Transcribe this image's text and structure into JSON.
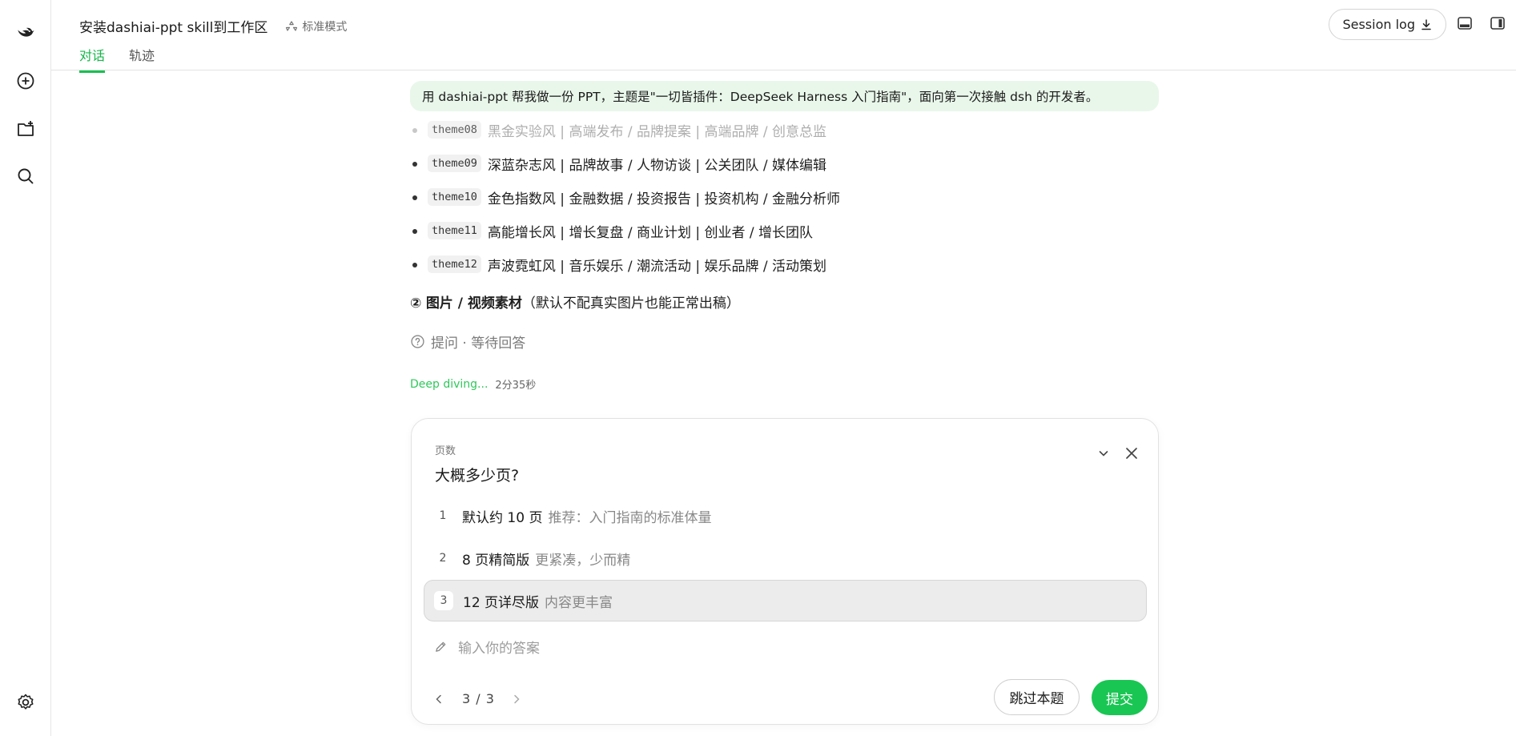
{
  "header": {
    "title": "安装dashiai-ppt skill到工作区",
    "mode_label": "标准模式",
    "tabs": [
      {
        "label": "对话",
        "active": true
      },
      {
        "label": "轨迹",
        "active": false
      }
    ],
    "session_log_label": "Session log"
  },
  "sidebar": {
    "items": [
      {
        "icon": "whale-logo-icon"
      },
      {
        "icon": "new-chat-icon"
      },
      {
        "icon": "add-folder-icon"
      },
      {
        "icon": "search-icon"
      },
      {
        "icon": "settings-icon"
      }
    ]
  },
  "chat": {
    "user_message": "用 dashiai-ppt 帮我做一份 PPT，主题是\"一切皆插件：DeepSeek Harness 入门指南\"，面向第一次接触 dsh 的开发者。",
    "themes": [
      {
        "code": "theme08",
        "text": "黑金实验风 | 高端发布 / 品牌提案 | 高端品牌 / 创意总监",
        "faded": true
      },
      {
        "code": "theme09",
        "text": "深蓝杂志风 | 品牌故事 / 人物访谈 | 公关团队 / 媒体编辑"
      },
      {
        "code": "theme10",
        "text": "金色指数风 | 金融数据 / 投资报告 | 投资机构 / 金融分析师"
      },
      {
        "code": "theme11",
        "text": "高能增长风 | 增长复盘 / 商业计划 | 创业者 / 增长团队"
      },
      {
        "code": "theme12",
        "text": "声波霓虹风 | 音乐娱乐 / 潮流活动 | 娱乐品牌 / 活动策划"
      }
    ],
    "section_number": "②",
    "section_title": "图片 / 视频素材",
    "section_note": "（默认不配真实图片也能正常出稿）",
    "ask_status": "提问 · 等待回答",
    "deep_label": "Deep diving...",
    "deep_time": "2分35秒"
  },
  "question": {
    "category": "页数",
    "text": "大概多少页?",
    "options": [
      {
        "num": "1",
        "title": "默认约 10 页",
        "hint": "推荐：入门指南的标准体量",
        "selected": false
      },
      {
        "num": "2",
        "title": "8 页精简版",
        "hint": "更紧凑，少而精",
        "selected": false
      },
      {
        "num": "3",
        "title": "12 页详尽版",
        "hint": "内容更丰富",
        "selected": true
      }
    ],
    "answer_placeholder": "输入你的答案",
    "pager": "3 / 3",
    "skip_label": "跳过本题",
    "submit_label": "提交"
  },
  "colors": {
    "accent": "#19c653",
    "bubble_bg": "#e9f7ea",
    "selected_bg": "#ececec"
  }
}
